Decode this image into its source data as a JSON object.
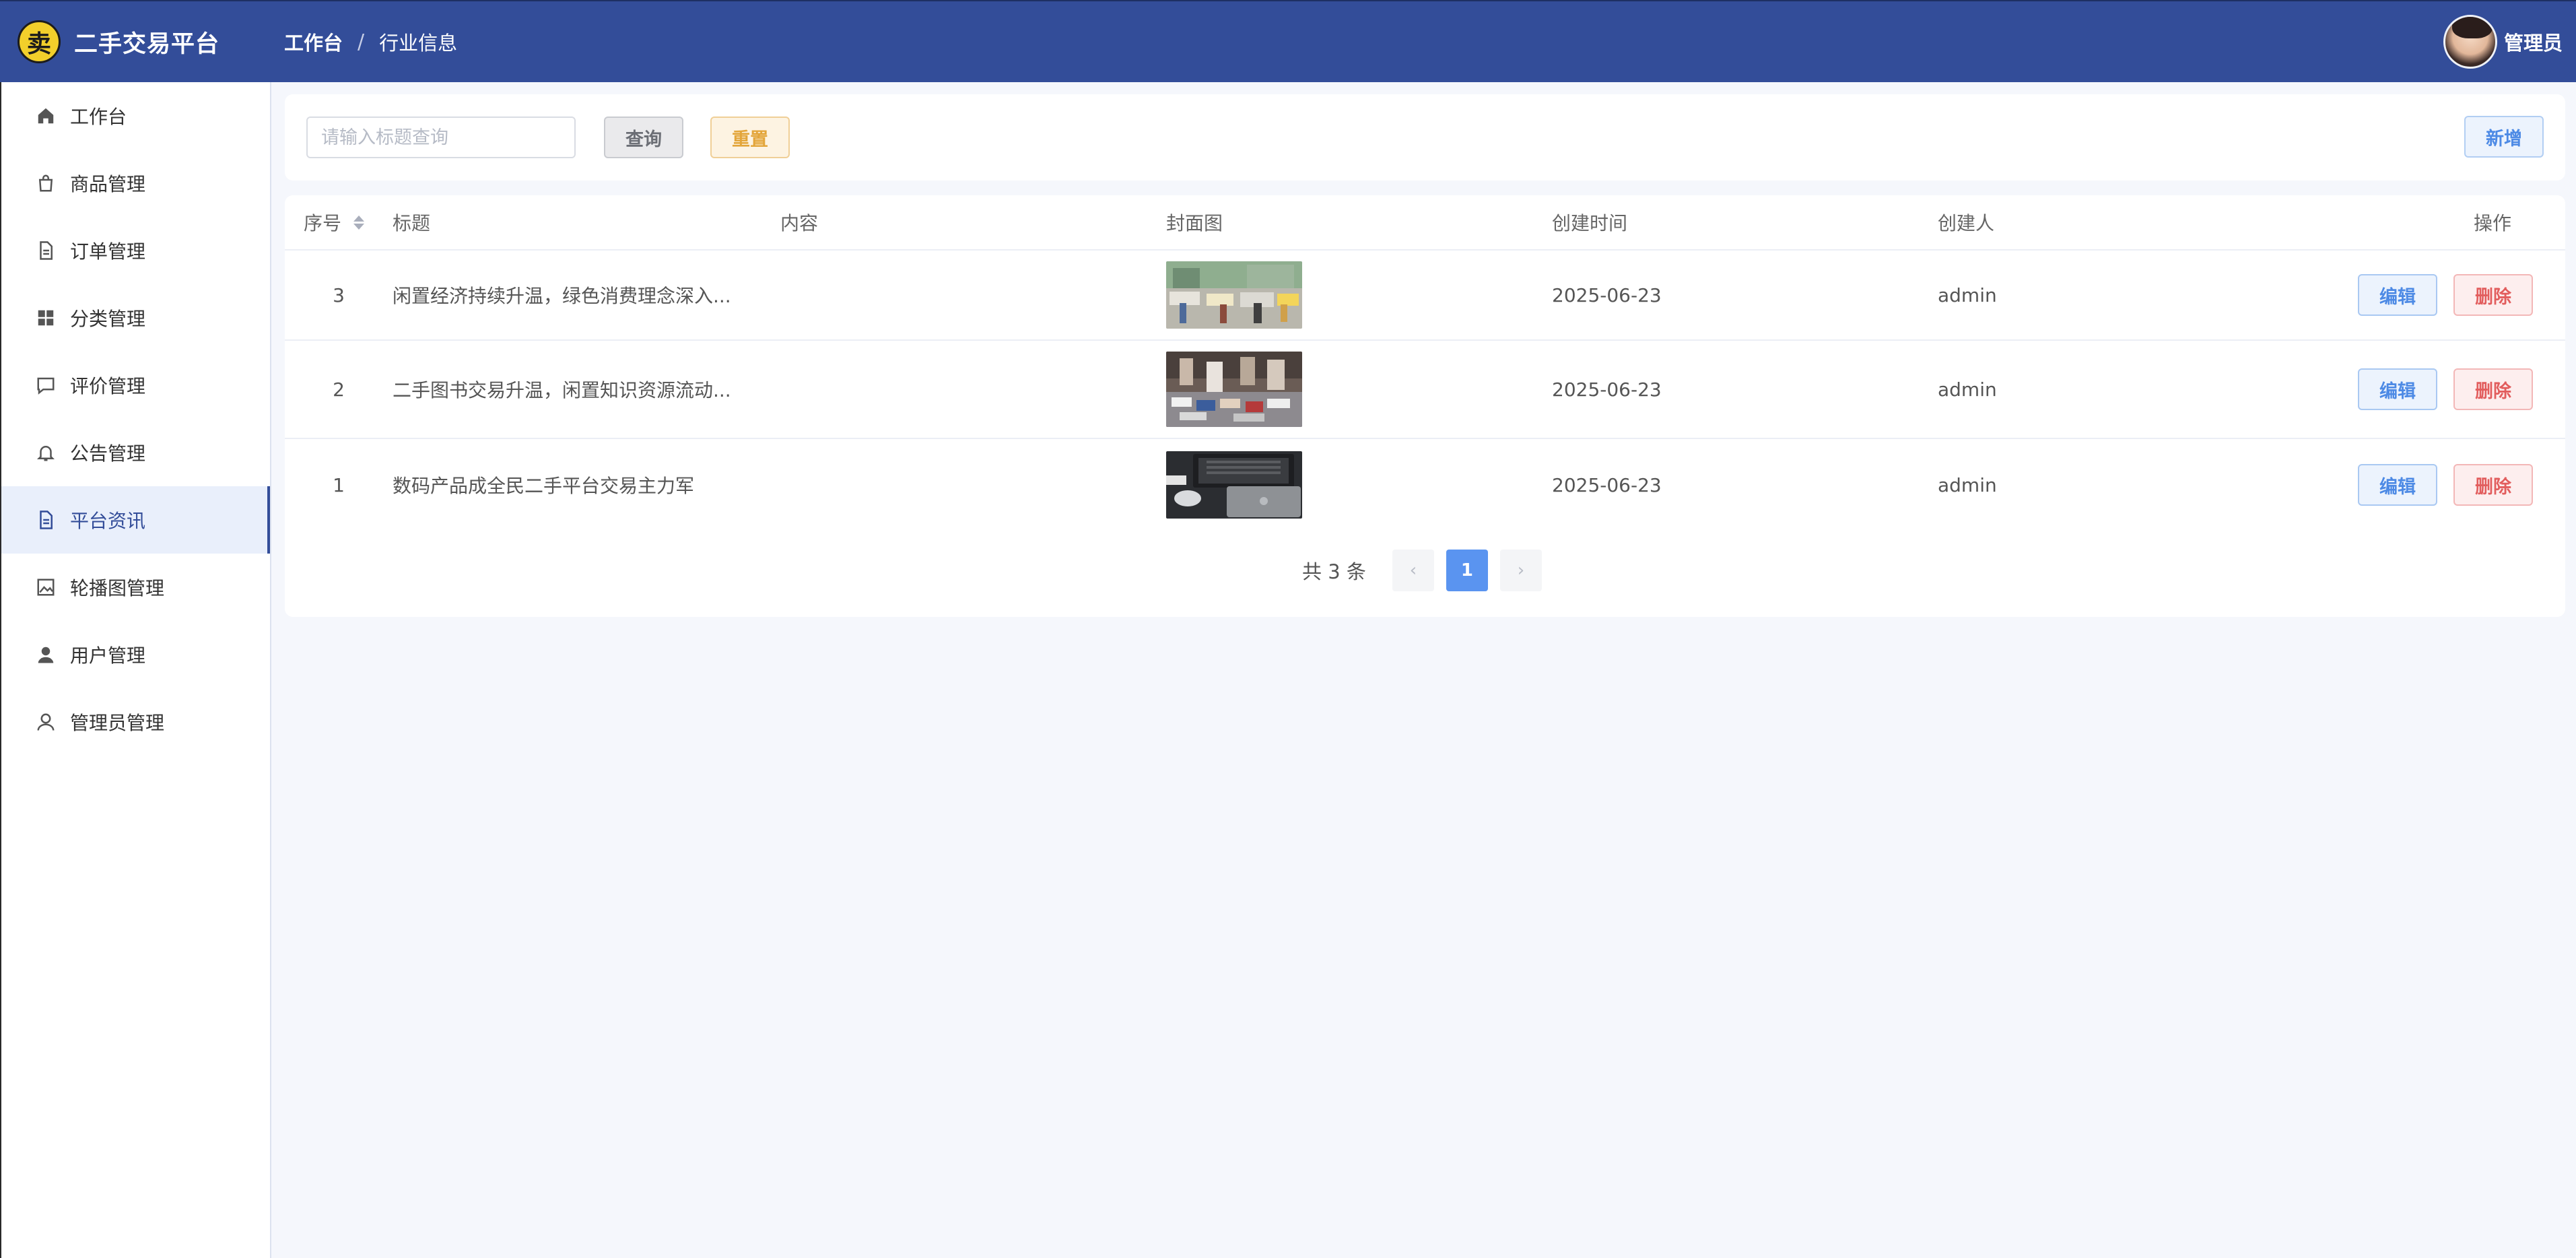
{
  "app": {
    "logo_char": "卖",
    "title": "二手交易平台"
  },
  "breadcrumb": {
    "root": "工作台",
    "separator": "/",
    "current": "行业信息"
  },
  "user": {
    "name": "管理员"
  },
  "sidebar": {
    "items": [
      {
        "label": "工作台",
        "icon": "home-icon"
      },
      {
        "label": "商品管理",
        "icon": "shopping-bag-icon"
      },
      {
        "label": "订单管理",
        "icon": "document-icon"
      },
      {
        "label": "分类管理",
        "icon": "grid-icon"
      },
      {
        "label": "评价管理",
        "icon": "chat-bubble-icon"
      },
      {
        "label": "公告管理",
        "icon": "bell-icon"
      },
      {
        "label": "平台资讯",
        "icon": "document-icon",
        "active": true
      },
      {
        "label": "轮播图管理",
        "icon": "image-icon"
      },
      {
        "label": "用户管理",
        "icon": "user-filled-icon"
      },
      {
        "label": "管理员管理",
        "icon": "user-outline-icon"
      }
    ]
  },
  "search": {
    "placeholder": "请输入标题查询",
    "value": "",
    "query_label": "查询",
    "reset_label": "重置",
    "add_label": "新增"
  },
  "table": {
    "columns": {
      "index": "序号",
      "title": "标题",
      "content": "内容",
      "cover": "封面图",
      "created_at": "创建时间",
      "creator": "创建人",
      "actions": "操作"
    },
    "rows": [
      {
        "index": "3",
        "title": "闲置经济持续升温，绿色消费理念深入...",
        "content": "",
        "cover": "market-stalls-photo",
        "created_at": "2025-06-23",
        "creator": "admin"
      },
      {
        "index": "2",
        "title": "二手图书交易升温，闲置知识资源流动...",
        "content": "",
        "cover": "book-fair-photo",
        "created_at": "2025-06-23",
        "creator": "admin"
      },
      {
        "index": "1",
        "title": "数码产品成全民二手平台交易主力军",
        "content": "",
        "cover": "laptop-desk-photo",
        "created_at": "2025-06-23",
        "creator": "admin"
      }
    ],
    "edit_label": "编辑",
    "delete_label": "删除"
  },
  "pagination": {
    "total_text": "共 3 条",
    "current_page": "1",
    "prev_icon": "chevron-left-icon",
    "next_icon": "chevron-right-icon"
  },
  "colors": {
    "header_bg": "#334d99",
    "accent": "#334d99",
    "primary_button": "#4d8ae5",
    "danger_button": "#e25d5d",
    "warning_button": "#e3a53a",
    "page_active": "#5a94f0"
  }
}
